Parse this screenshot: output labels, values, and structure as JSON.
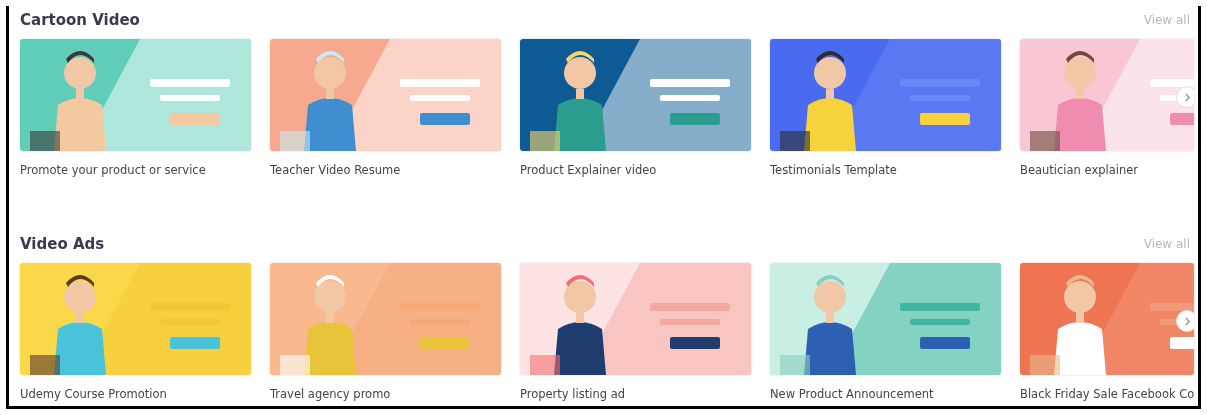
{
  "sections": [
    {
      "title": "Cartoon Video",
      "view_all": "View all",
      "cards": [
        {
          "caption": "Promote your product or service"
        },
        {
          "caption": "Teacher Video Resume"
        },
        {
          "caption": "Product Explainer video"
        },
        {
          "caption": "Testimonials Template"
        },
        {
          "caption": "Beautician explainer"
        }
      ]
    },
    {
      "title": "Video Ads",
      "view_all": "View all",
      "cards": [
        {
          "caption": "Udemy Course Promotion"
        },
        {
          "caption": "Travel agency promo"
        },
        {
          "caption": "Property listing ad"
        },
        {
          "caption": "New Product Announcement"
        },
        {
          "caption": "Black Friday Sale Facebook Co"
        }
      ]
    }
  ]
}
